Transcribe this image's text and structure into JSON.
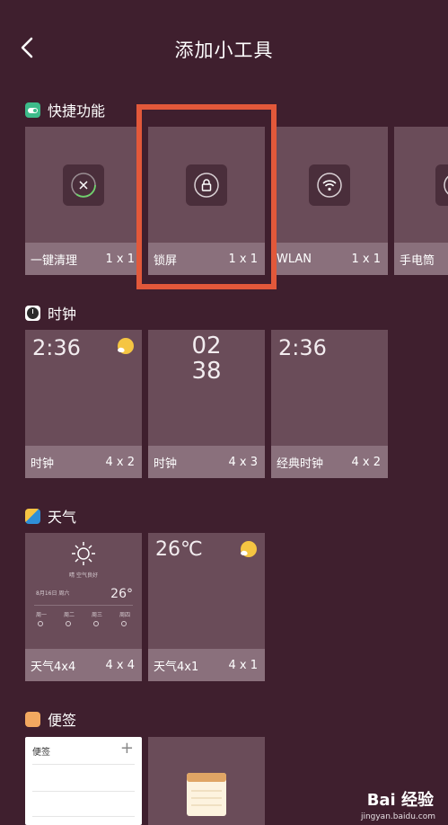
{
  "header": {
    "title": "添加小工具"
  },
  "sections": {
    "quick": {
      "title": "快捷功能",
      "cards": [
        {
          "name": "一键清理",
          "size": "1 x 1"
        },
        {
          "name": "锁屏",
          "size": "1 x 1"
        },
        {
          "name": "WLAN",
          "size": "1 x 1"
        },
        {
          "name": "手电筒",
          "size": ""
        }
      ]
    },
    "clock": {
      "title": "时钟",
      "cards": [
        {
          "name": "时钟",
          "size": "4 x 2",
          "time": "2:36"
        },
        {
          "name": "时钟",
          "size": "4 x 3",
          "hour": "02",
          "minute": "38"
        },
        {
          "name": "经典时钟",
          "size": "4 x 2",
          "time": "2:36"
        }
      ]
    },
    "weather": {
      "title": "天气",
      "cards": [
        {
          "name": "天气4x4",
          "size": "4 x 4",
          "temp": "26°",
          "status": "晴 空气良好",
          "date": "8月16日 周六",
          "days": [
            "周一",
            "周二",
            "周三",
            "周四"
          ]
        },
        {
          "name": "天气4x1",
          "size": "4 x 1",
          "temp": "26℃"
        }
      ]
    },
    "memo": {
      "title": "便签",
      "cards": [
        {
          "name": "便签",
          "plus": "+"
        }
      ]
    }
  },
  "watermark": {
    "brand": "Bai 经验",
    "url": "jingyan.baidu.com"
  },
  "colors": {
    "background": "#3f1f2e",
    "card": "#6a4c59",
    "card_bar": "#8a707c",
    "highlight": "#e2583a"
  }
}
